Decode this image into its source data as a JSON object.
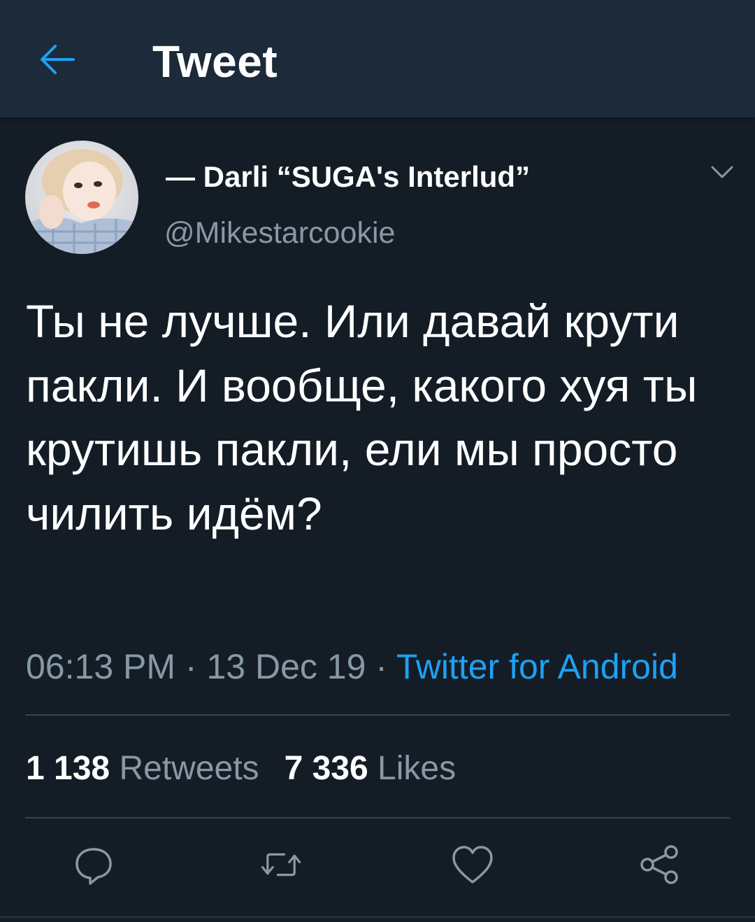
{
  "header": {
    "title": "Tweet",
    "back_icon": "arrow-left-icon"
  },
  "author": {
    "display_name": "— Darli “SUGA's Interlud”",
    "handle": "@Mikestarcookie",
    "avatar_icon": "avatar"
  },
  "tweet": {
    "text": "Ты не лучше. Или давай крути пакли. И вообще, какого хуя ты крутишь пакли, ели мы просто чилить идём?",
    "time": "06:13 PM",
    "date": "13 Dec 19",
    "separator": " · ",
    "source": "Twitter for Android"
  },
  "stats": {
    "retweets_count": "1 138",
    "retweets_label": "Retweets",
    "likes_count": "7 336",
    "likes_label": "Likes"
  },
  "actions": [
    "reply-icon",
    "retweet-icon",
    "like-icon",
    "share-icon"
  ],
  "colors": {
    "background": "#141d26",
    "header": "#1c2a3a",
    "accent": "#1da1f2",
    "secondary_text": "#8899a6",
    "divider": "#38444d"
  }
}
